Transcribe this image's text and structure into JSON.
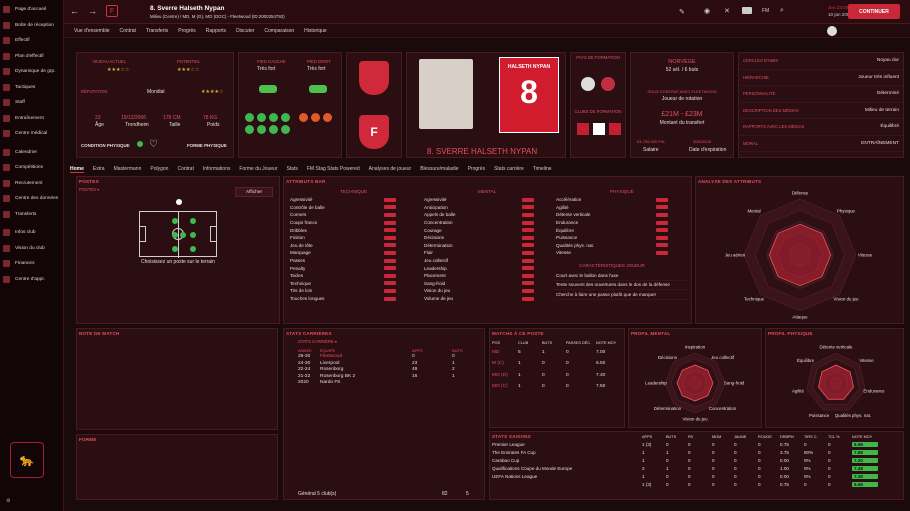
{
  "sidebar": {
    "items": [
      "Page d'accueil",
      "Boîte de réception",
      "Effectif",
      "Plan d'effectif",
      "Dynamique de grp.",
      "Tactiques",
      "Staff",
      "Entraînement",
      "Centre médical",
      "Calendrier",
      "Compétitions",
      "Recrutement",
      "Centre des données",
      "Transferts",
      "Infos club",
      "Vision du club",
      "Finances",
      "Centre d'appr."
    ]
  },
  "header": {
    "title": "8. Sverre Halseth Nypan",
    "subtitle": "Milieu (Centre) / MD, M (G), MO (DGC) - Fleetwood (ID:2000254793)",
    "date": "Jeu 23:00",
    "date2": "10 jan 2008",
    "continue": "CONTINUER",
    "fm": "FM"
  },
  "subnav": [
    "Vue d'ensemble",
    "Contrat",
    "Transferts",
    "Progrès",
    "Rapports",
    "Discuter",
    "Comparaison",
    "Historique"
  ],
  "profile": {
    "reputation_label": "RÉPUTATION",
    "reputation": "Mondial",
    "potential_label": "POTENTIEL",
    "actual_label": "NIVEAU ACTUEL",
    "age": "23",
    "age_label": "Âge",
    "dob": "19/12/2006",
    "birthplace": "Trondheim",
    "height": "178 CM",
    "height_label": "Taille",
    "weight": "78 KG",
    "weight_label": "Poids",
    "condition": "CONDITION PHYSIQUE",
    "form": "FORME PHYSIQUE",
    "pied_g_label": "PIED GAUCHE",
    "pied_g": "Très fort",
    "pied_d_label": "PIED DROIT",
    "pied_d": "Très fort",
    "name_big": "8. SVERRE HALSETH NYPAN",
    "shirt_name": "HALSETH NYPAN",
    "shirt_no": "8",
    "form_label": "PAYS DE FORMATION",
    "club_form_label": "CLUBS DE FORMATION",
    "nation": "NORVÈGE",
    "caps": "52 sél. / 6 buts",
    "contract_label": "SOUS CONTRAT AVEC FLEETWOOD",
    "contract": "Joueur de rotation",
    "value": "£21M - £23M",
    "value_label": "Montant du transfert",
    "salary": "£4,750,000 P/A",
    "salary_label": "Salaire",
    "expiry": "30/6/2028",
    "expiry_label": "Date d'expiration"
  },
  "traits": [
    [
      "CERCLES D'AMIS",
      "Noyau dur"
    ],
    [
      "HIÉRARCHIE",
      "Joueur très influent"
    ],
    [
      "PERSONNALITÉ",
      "Déterminé"
    ],
    [
      "DESCRIPTION DES MÉDIAS",
      "Milieu de terrain"
    ],
    [
      "RAPPORTS AVEC LES MÉDIAS",
      "Équilibré"
    ],
    [
      "MORAL",
      "ENTRAÎNEMENT"
    ]
  ],
  "tabs": [
    "Home",
    "Extra",
    "Mastermann",
    "Polygon",
    "Contrat",
    "Informations",
    "Forme du Joueur",
    "Stats",
    "FM Stag Stats Powered",
    "Analyses de joueur",
    "Blessure/maladie",
    "Progrès",
    "Stats carrière",
    "Timeline"
  ],
  "postes": {
    "title": "POSTES",
    "sub": "POSTES ▾",
    "choose": "Choisissez un poste sur le terrain",
    "show": "Afficher"
  },
  "attributes": {
    "title": "ATTRIBUTS BAR",
    "technique_title": "TECHNIQUE",
    "mental_title": "MENTAL",
    "physique_title": "PHYSIQUE",
    "technique": [
      "Agressivité",
      "Contrôle de balle",
      "Corners",
      "Coups francs",
      "Dribbles",
      "Finition",
      "Jeu de tête",
      "Marquage",
      "Passes",
      "Penalty",
      "Tacles",
      "Technique",
      "Tirs de loin",
      "Touches longues"
    ],
    "mental": [
      "Agressivité",
      "Anticipation",
      "Appels de balle",
      "Concentration",
      "Courage",
      "Décisions",
      "Détermination",
      "Flair",
      "Jeu collectif",
      "Leadership",
      "Placement",
      "Sang-froid",
      "Vision du jeu",
      "Volume de jeu"
    ],
    "physique": [
      "Accélération",
      "Agilité",
      "Détente verticale",
      "Endurance",
      "Équilibre",
      "Puissance",
      "Qualités phys. nat.",
      "Vitesse"
    ],
    "chars_title": "CARACTÉRISTIQUES JOUEUR",
    "chars": [
      "Court avec le ballon dans l'axe",
      "Tente souvent des ouvertures dans le dos de la défense",
      "Cherche à faire une passe plutôt que de marquer"
    ]
  },
  "analysis": {
    "title": "ANALYSE DES ATTRIBUTS",
    "labels": [
      "Défense",
      "Physique",
      "Vitesse",
      "Vision du jeu",
      "Attaque",
      "Technique",
      "Jeu aérien",
      "Mental"
    ]
  },
  "note": {
    "title": "NOTE DE MATCH"
  },
  "forme": {
    "title": "FORME"
  },
  "career": {
    "title": "STATS CARRIÈRES",
    "sub": "STATS CARRIÈRE ▾",
    "h": [
      "ANNÉE",
      "ÉQUIPE",
      "APPS",
      "BUTS"
    ],
    "rows": [
      [
        "29-30",
        "Fleetwood",
        "0",
        "0"
      ],
      [
        "24-30",
        "Liverpool",
        "23",
        "1"
      ],
      [
        "22-24",
        "Rosenborg",
        "49",
        "2"
      ],
      [
        "21-22",
        "Rosenborg BK 2",
        "16",
        "1"
      ],
      [
        "2020",
        "Nardo FK",
        "",
        ""
      ]
    ],
    "total": "Général 5 club(s)",
    "total_apps": "82",
    "total_goals": "5"
  },
  "matches": {
    "title": "MATCHS À CE POSTE",
    "h": [
      "POS",
      "CLUB",
      "BUTS",
      "PASSES DÉC.",
      "NOTE MOY"
    ],
    "rows": [
      [
        "MD",
        "5",
        "1",
        "0",
        "7.00"
      ],
      [
        "M (C)",
        "1",
        "0",
        "0",
        "6.50"
      ],
      [
        "MO (D)",
        "1",
        "0",
        "0",
        "7.40"
      ],
      [
        "MO (C)",
        "1",
        "0",
        "0",
        "7.50"
      ]
    ]
  },
  "mental_profile": {
    "title": "PROFIL MENTAL",
    "labels": [
      "Inspiration",
      "Jeu collectif",
      "Sang-froid",
      "Concentration",
      "Vision du jeu",
      "Détermination",
      "Leadership",
      "Décisions"
    ]
  },
  "phys_profile": {
    "title": "PROFIL PHYSIQUE",
    "labels": [
      "Détente verticale",
      "Vitesse",
      "Endurance",
      "Qualités phys. nat.",
      "Puissance",
      "Agilité",
      "Équilibre"
    ]
  },
  "seasons": {
    "title": "STATS SAISONS",
    "h": [
      "APPS",
      "BUTS",
      "PD",
      "MOM",
      "JAUNE",
      "ROUGE",
      "DRBPM",
      "TIRS C.",
      "TCL %",
      "NOTE MOY"
    ],
    "rows": [
      [
        "Premier League",
        "1 (3)",
        "0",
        "0",
        "0",
        "0",
        "0",
        "0.75",
        "0",
        "0",
        "6.95"
      ],
      [
        "The Emirates FA Cup",
        "1",
        "1",
        "0",
        "0",
        "0",
        "0",
        "3.75",
        "80%",
        "0",
        "7.68"
      ],
      [
        "Carabao Cup",
        "1",
        "0",
        "0",
        "0",
        "0",
        "0",
        "0.00",
        "0%",
        "0",
        "7.20"
      ],
      [
        "Qualifications Coupe du Monde Europe",
        "2",
        "1",
        "0",
        "0",
        "0",
        "0",
        "1.00",
        "0%",
        "0",
        "7.48"
      ],
      [
        "UEFA Nations League",
        "1",
        "0",
        "0",
        "0",
        "0",
        "0",
        "0.00",
        "0%",
        "0",
        "7.30"
      ],
      [
        "",
        "1 (3)",
        "0",
        "0",
        "0",
        "0",
        "0",
        "0.75",
        "0",
        "0",
        "6.65"
      ]
    ]
  }
}
